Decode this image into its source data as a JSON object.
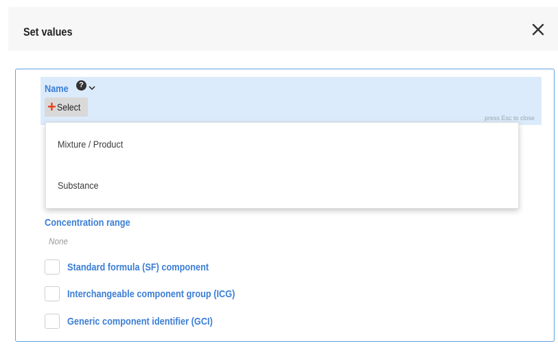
{
  "dialog": {
    "title": "Set values",
    "close_icon": "close-icon"
  },
  "name_field": {
    "label": "Name",
    "help_icon": "question-circle-icon",
    "help_glyph": "?",
    "chevron_icon": "chevron-down-icon",
    "select_icon": "plus-icon",
    "select_glyph": "+",
    "select_label": "Select",
    "esc_hint": "press Esc to close"
  },
  "dropdown": {
    "options": [
      {
        "label": "Mixture / Product"
      },
      {
        "label": "Substance"
      }
    ]
  },
  "concentration": {
    "label": "Concentration range",
    "value": "None"
  },
  "checkboxes": [
    {
      "label": "Standard formula (SF) component",
      "checked": false
    },
    {
      "label": "Interchangeable component group (ICG)",
      "checked": false
    },
    {
      "label": "Generic component identifier (GCI)",
      "checked": false
    }
  ],
  "colors": {
    "accent": "#3b7ed6",
    "border": "#5f9fe0",
    "highlight": "#dcebfb",
    "plus": "#e8401c"
  }
}
